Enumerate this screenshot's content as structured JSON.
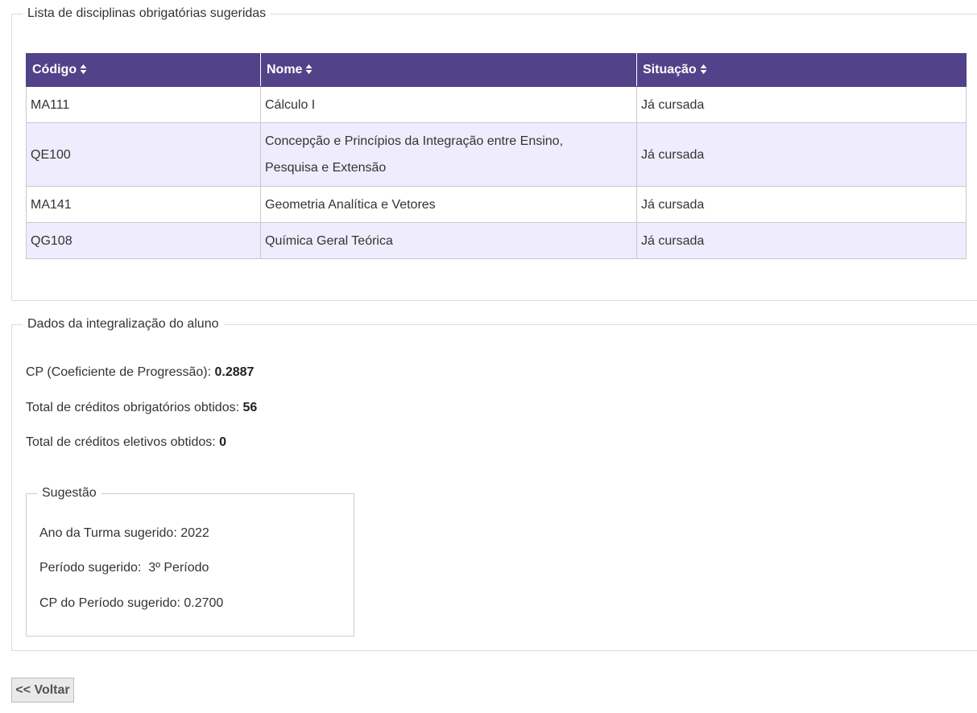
{
  "disciplinas": {
    "legend": "Lista de disciplinas obrigatórias sugeridas",
    "headers": {
      "codigo": "Código",
      "nome": "Nome",
      "situacao": "Situação"
    },
    "rows": [
      {
        "codigo": "MA111",
        "nome": "Cálculo I",
        "situacao": "Já cursada"
      },
      {
        "codigo": "QE100",
        "nome_linha1": "Concepção e Princípios da Integração entre Ensino,",
        "nome_linha2": "Pesquisa e Extensão",
        "situacao": "Já cursada"
      },
      {
        "codigo": "MA141",
        "nome": "Geometria Analítica e Vetores",
        "situacao": "Já cursada"
      },
      {
        "codigo": "QG108",
        "nome": "Química Geral Teórica",
        "situacao": "Já cursada"
      }
    ],
    "colors": {
      "header_bg": "#524289",
      "row_alt_bg": "#efedfd"
    }
  },
  "integralizacao": {
    "legend": "Dados da integralização do aluno",
    "cp_label": "CP (Coeficiente de Progressão): ",
    "cp_value": "0.2887",
    "obrig_label": "Total de créditos obrigatórios obtidos: ",
    "obrig_value": "56",
    "eletivos_label": "Total de créditos eletivos obtidos: ",
    "eletivos_value": "0",
    "sugestao": {
      "legend": "Sugestão",
      "ano": "Ano da Turma sugerido: 2022",
      "periodo": "Período sugerido:  3º Período",
      "cp_periodo": "CP do Período sugerido: 0.2700"
    }
  },
  "voltar_label": "<< Voltar"
}
